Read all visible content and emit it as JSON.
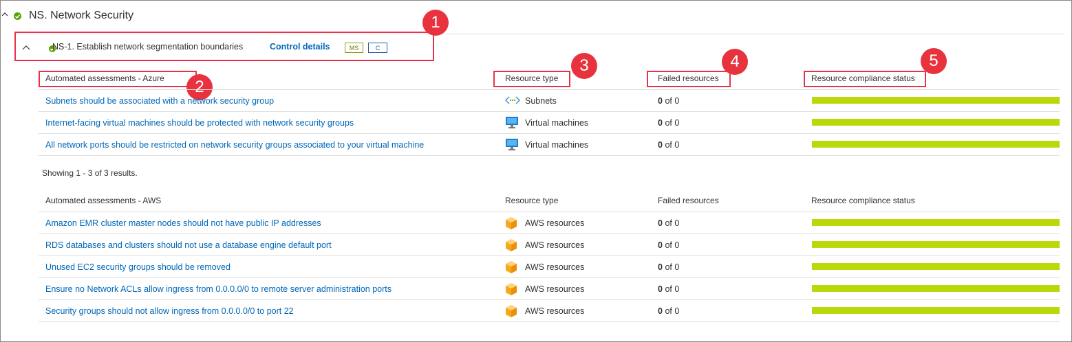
{
  "section": {
    "title": "NS. Network Security"
  },
  "control": {
    "title": "NS-1. Establish network segmentation boundaries",
    "details_link": "Control details",
    "badges": [
      "MS",
      "C"
    ]
  },
  "callouts": [
    "1",
    "2",
    "3",
    "4",
    "5"
  ],
  "columns": {
    "resource_type": "Resource type",
    "failed": "Failed resources",
    "status": "Resource compliance status"
  },
  "azure": {
    "header": "Automated assessments - Azure",
    "rows": [
      {
        "name": "Subnets should be associated with a network security group",
        "rtype": "Subnets",
        "icon": "subnet-icon",
        "failed_count": "0",
        "failed_of": "of 0",
        "compliance": 1.0
      },
      {
        "name": "Internet-facing virtual machines should be protected with network security groups",
        "rtype": "Virtual machines",
        "icon": "vm-icon",
        "failed_count": "0",
        "failed_of": "of 0",
        "compliance": 1.0
      },
      {
        "name": "All network ports should be restricted on network security groups associated to your virtual machine",
        "rtype": "Virtual machines",
        "icon": "vm-icon",
        "failed_count": "0",
        "failed_of": "of 0",
        "compliance": 1.0
      }
    ],
    "showing": "Showing 1 - 3 of 3 results."
  },
  "aws": {
    "header": "Automated assessments - AWS",
    "rows": [
      {
        "name": "Amazon EMR cluster master nodes should not have public IP addresses",
        "rtype": "AWS resources",
        "icon": "aws-cube-icon",
        "failed_count": "0",
        "failed_of": "of 0",
        "compliance": 1.0
      },
      {
        "name": "RDS databases and clusters should not use a database engine default port",
        "rtype": "AWS resources",
        "icon": "aws-cube-icon",
        "failed_count": "0",
        "failed_of": "of 0",
        "compliance": 1.0
      },
      {
        "name": "Unused EC2 security groups should be removed",
        "rtype": "AWS resources",
        "icon": "aws-cube-icon",
        "failed_count": "0",
        "failed_of": "of 0",
        "compliance": 1.0
      },
      {
        "name": "Ensure no Network ACLs allow ingress from 0.0.0.0/0 to remote server administration ports",
        "rtype": "AWS resources",
        "icon": "aws-cube-icon",
        "failed_count": "0",
        "failed_of": "of 0",
        "compliance": 1.0
      },
      {
        "name": "Security groups should not allow ingress from 0.0.0.0/0 to port 22",
        "rtype": "AWS resources",
        "icon": "aws-cube-icon",
        "failed_count": "0",
        "failed_of": "of 0",
        "compliance": 1.0
      }
    ]
  },
  "colors": {
    "accent_link": "#0067b8",
    "compliance_bar": "#bad80a",
    "callout": "#e8333f",
    "status_ok": "#57a300"
  }
}
